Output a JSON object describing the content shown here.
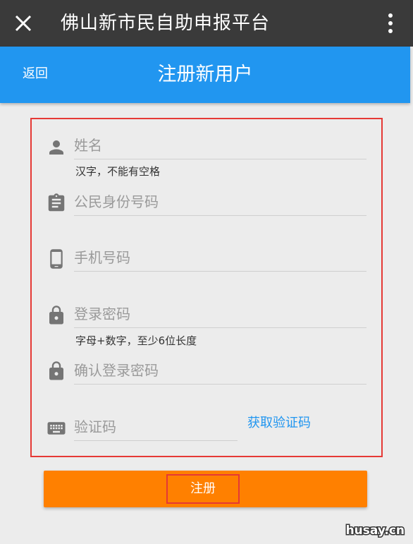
{
  "app_bar": {
    "title": "佛山新市民自助申报平台"
  },
  "header": {
    "back_label": "返回",
    "title": "注册新用户"
  },
  "form": {
    "name": {
      "placeholder": "姓名",
      "hint": "汉字，不能有空格"
    },
    "id_number": {
      "placeholder": "公民身份号码"
    },
    "phone": {
      "placeholder": "手机号码"
    },
    "password": {
      "placeholder": "登录密码",
      "hint": "字母+数字，至少6位长度"
    },
    "confirm_password": {
      "placeholder": "确认登录密码"
    },
    "code": {
      "placeholder": "验证码",
      "get_code_label": "获取验证码"
    }
  },
  "submit_label": "注册",
  "watermark": "husay.cn",
  "colors": {
    "app_bar": "#3a3a3a",
    "header": "#2196f0",
    "submit": "#ff8000",
    "highlight": "#e53935"
  }
}
